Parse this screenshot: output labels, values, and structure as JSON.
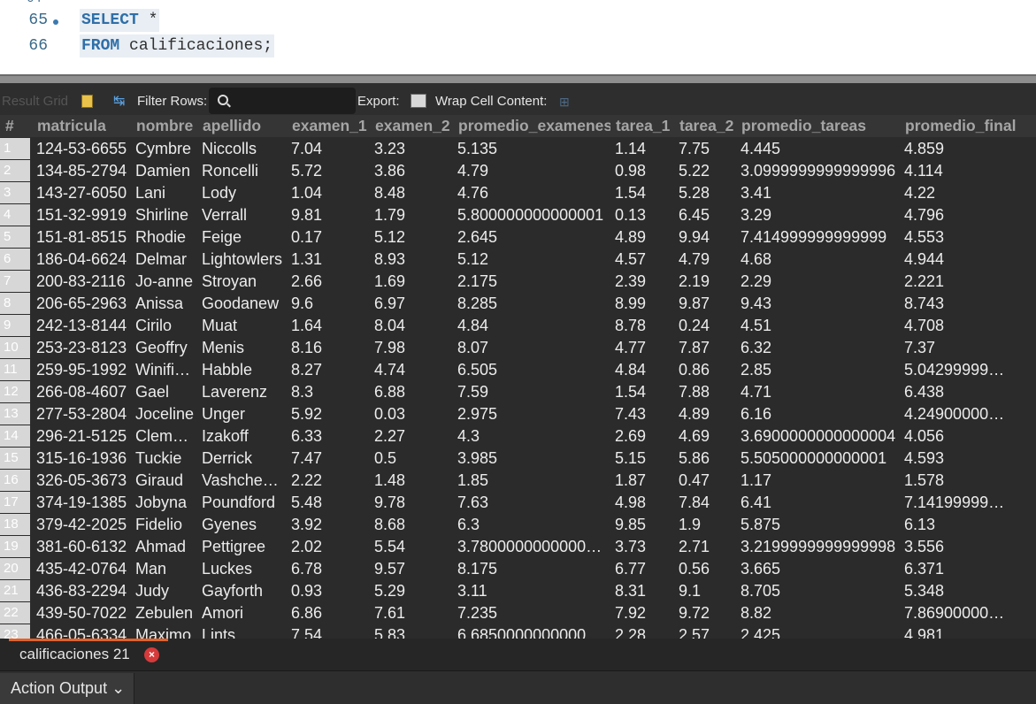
{
  "editor": {
    "line65": {
      "num": "65",
      "keyword": "SELECT",
      "rest": " *"
    },
    "line66": {
      "num": "66",
      "keyword": "FROM",
      "rest": " calificaciones;"
    }
  },
  "toolbar": {
    "result_grid": "Result Grid",
    "filter_rows": "Filter Rows:",
    "export": "Export:",
    "wrap": "Wrap Cell Content:"
  },
  "columns": [
    "#",
    "matricula",
    "nombre",
    "apellido",
    "examen_1",
    "examen_2",
    "promedio_examenes",
    "tarea_1",
    "tarea_2",
    "promedio_tareas",
    "promedio_final"
  ],
  "rows": [
    [
      "1",
      "124-53-6655",
      "Cymbre",
      "Niccolls",
      "7.04",
      "3.23",
      "5.135",
      "1.14",
      "7.75",
      "4.445",
      "4.859"
    ],
    [
      "2",
      "134-85-2794",
      "Damien",
      "Roncelli",
      "5.72",
      "3.86",
      "4.79",
      "0.98",
      "5.22",
      "3.0999999999999996",
      "4.114"
    ],
    [
      "3",
      "143-27-6050",
      "Lani",
      "Lody",
      "1.04",
      "8.48",
      "4.76",
      "1.54",
      "5.28",
      "3.41",
      "4.22"
    ],
    [
      "4",
      "151-32-9919",
      "Shirline",
      "Verrall",
      "9.81",
      "1.79",
      "5.800000000000001",
      "0.13",
      "6.45",
      "3.29",
      "4.796"
    ],
    [
      "5",
      "151-81-8515",
      "Rhodie",
      "Feige",
      "0.17",
      "5.12",
      "2.645",
      "4.89",
      "9.94",
      "7.414999999999999",
      "4.553"
    ],
    [
      "6",
      "186-04-6624",
      "Delmar",
      "Lightowlers",
      "1.31",
      "8.93",
      "5.12",
      "4.57",
      "4.79",
      "4.68",
      "4.944"
    ],
    [
      "7",
      "200-83-2116",
      "Jo-anne",
      "Stroyan",
      "2.66",
      "1.69",
      "2.175",
      "2.39",
      "2.19",
      "2.29",
      "2.221"
    ],
    [
      "8",
      "206-65-2963",
      "Anissa",
      "Goodanew",
      "9.6",
      "6.97",
      "8.285",
      "8.99",
      "9.87",
      "9.43",
      "8.743"
    ],
    [
      "9",
      "242-13-8144",
      "Cirilo",
      "Muat",
      "1.64",
      "8.04",
      "4.84",
      "8.78",
      "0.24",
      "4.51",
      "4.708"
    ],
    [
      "10",
      "253-23-8123",
      "Geoffry",
      "Menis",
      "8.16",
      "7.98",
      "8.07",
      "4.77",
      "7.87",
      "6.32",
      "7.37"
    ],
    [
      "11",
      "259-95-1992",
      "Winifi…",
      "Habble",
      "8.27",
      "4.74",
      "6.505",
      "4.84",
      "0.86",
      "2.85",
      "5.04299999…"
    ],
    [
      "12",
      "266-08-4607",
      "Gael",
      "Laverenz",
      "8.3",
      "6.88",
      "7.59",
      "1.54",
      "7.88",
      "4.71",
      "6.438"
    ],
    [
      "13",
      "277-53-2804",
      "Joceline",
      "Unger",
      "5.92",
      "0.03",
      "2.975",
      "7.43",
      "4.89",
      "6.16",
      "4.24900000…"
    ],
    [
      "14",
      "296-21-5125",
      "Clem…",
      "Izakoff",
      "6.33",
      "2.27",
      "4.3",
      "2.69",
      "4.69",
      "3.6900000000000004",
      "4.056"
    ],
    [
      "15",
      "315-16-1936",
      "Tuckie",
      "Derrick",
      "7.47",
      "0.5",
      "3.985",
      "5.15",
      "5.86",
      "5.505000000000001",
      "4.593"
    ],
    [
      "16",
      "326-05-3673",
      "Giraud",
      "Vashche…",
      "2.22",
      "1.48",
      "1.85",
      "1.87",
      "0.47",
      "1.17",
      "1.578"
    ],
    [
      "17",
      "374-19-1385",
      "Jobyna",
      "Poundford",
      "5.48",
      "9.78",
      "7.63",
      "4.98",
      "7.84",
      "6.41",
      "7.14199999…"
    ],
    [
      "18",
      "379-42-2025",
      "Fidelio",
      "Gyenes",
      "3.92",
      "8.68",
      "6.3",
      "9.85",
      "1.9",
      "5.875",
      "6.13"
    ],
    [
      "19",
      "381-60-6132",
      "Ahmad",
      "Pettigree",
      "2.02",
      "5.54",
      "3.7800000000000…",
      "3.73",
      "2.71",
      "3.2199999999999998",
      "3.556"
    ],
    [
      "20",
      "435-42-0764",
      "Man",
      "Luckes",
      "6.78",
      "9.57",
      "8.175",
      "6.77",
      "0.56",
      "3.665",
      "6.371"
    ],
    [
      "21",
      "436-83-2294",
      "Judy",
      "Gayforth",
      "0.93",
      "5.29",
      "3.11",
      "8.31",
      "9.1",
      "8.705",
      "5.348"
    ],
    [
      "22",
      "439-50-7022",
      "Zebulen",
      "Amori",
      "6.86",
      "7.61",
      "7.235",
      "7.92",
      "9.72",
      "8.82",
      "7.86900000…"
    ],
    [
      "23",
      "466-05-6334",
      "Maximo",
      "Lints",
      "7.54",
      "5.83",
      "6.6850000000000…",
      "2.28",
      "2.57",
      "2.425",
      "4.981"
    ]
  ],
  "tab": {
    "label": "calificaciones 21",
    "close": "×"
  },
  "bottom": {
    "action_output": "Action Output ⌄"
  }
}
